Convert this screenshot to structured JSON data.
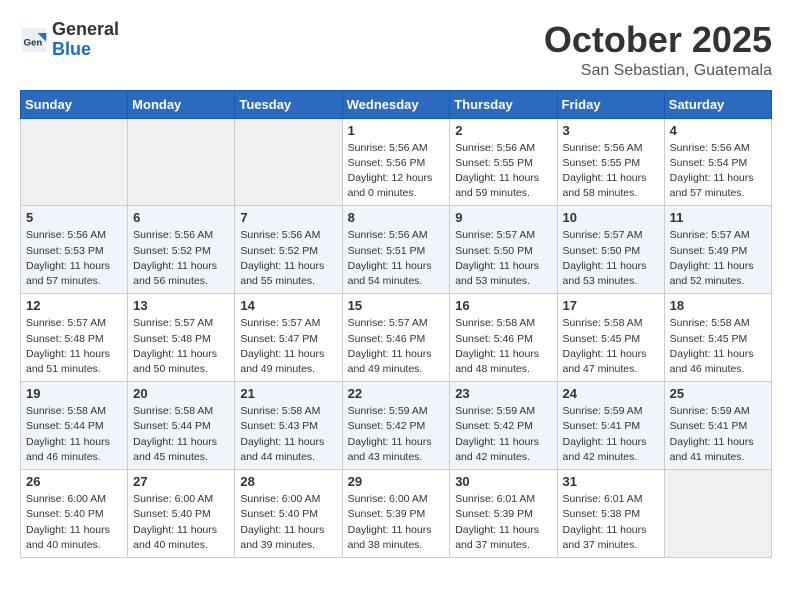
{
  "logo": {
    "general": "General",
    "blue": "Blue"
  },
  "header": {
    "month": "October 2025",
    "location": "San Sebastian, Guatemala"
  },
  "weekdays": [
    "Sunday",
    "Monday",
    "Tuesday",
    "Wednesday",
    "Thursday",
    "Friday",
    "Saturday"
  ],
  "weeks": [
    [
      {
        "day": "",
        "info": ""
      },
      {
        "day": "",
        "info": ""
      },
      {
        "day": "",
        "info": ""
      },
      {
        "day": "1",
        "info": "Sunrise: 5:56 AM\nSunset: 5:56 PM\nDaylight: 12 hours\nand 0 minutes."
      },
      {
        "day": "2",
        "info": "Sunrise: 5:56 AM\nSunset: 5:55 PM\nDaylight: 11 hours\nand 59 minutes."
      },
      {
        "day": "3",
        "info": "Sunrise: 5:56 AM\nSunset: 5:55 PM\nDaylight: 11 hours\nand 58 minutes."
      },
      {
        "day": "4",
        "info": "Sunrise: 5:56 AM\nSunset: 5:54 PM\nDaylight: 11 hours\nand 57 minutes."
      }
    ],
    [
      {
        "day": "5",
        "info": "Sunrise: 5:56 AM\nSunset: 5:53 PM\nDaylight: 11 hours\nand 57 minutes."
      },
      {
        "day": "6",
        "info": "Sunrise: 5:56 AM\nSunset: 5:52 PM\nDaylight: 11 hours\nand 56 minutes."
      },
      {
        "day": "7",
        "info": "Sunrise: 5:56 AM\nSunset: 5:52 PM\nDaylight: 11 hours\nand 55 minutes."
      },
      {
        "day": "8",
        "info": "Sunrise: 5:56 AM\nSunset: 5:51 PM\nDaylight: 11 hours\nand 54 minutes."
      },
      {
        "day": "9",
        "info": "Sunrise: 5:57 AM\nSunset: 5:50 PM\nDaylight: 11 hours\nand 53 minutes."
      },
      {
        "day": "10",
        "info": "Sunrise: 5:57 AM\nSunset: 5:50 PM\nDaylight: 11 hours\nand 53 minutes."
      },
      {
        "day": "11",
        "info": "Sunrise: 5:57 AM\nSunset: 5:49 PM\nDaylight: 11 hours\nand 52 minutes."
      }
    ],
    [
      {
        "day": "12",
        "info": "Sunrise: 5:57 AM\nSunset: 5:48 PM\nDaylight: 11 hours\nand 51 minutes."
      },
      {
        "day": "13",
        "info": "Sunrise: 5:57 AM\nSunset: 5:48 PM\nDaylight: 11 hours\nand 50 minutes."
      },
      {
        "day": "14",
        "info": "Sunrise: 5:57 AM\nSunset: 5:47 PM\nDaylight: 11 hours\nand 49 minutes."
      },
      {
        "day": "15",
        "info": "Sunrise: 5:57 AM\nSunset: 5:46 PM\nDaylight: 11 hours\nand 49 minutes."
      },
      {
        "day": "16",
        "info": "Sunrise: 5:58 AM\nSunset: 5:46 PM\nDaylight: 11 hours\nand 48 minutes."
      },
      {
        "day": "17",
        "info": "Sunrise: 5:58 AM\nSunset: 5:45 PM\nDaylight: 11 hours\nand 47 minutes."
      },
      {
        "day": "18",
        "info": "Sunrise: 5:58 AM\nSunset: 5:45 PM\nDaylight: 11 hours\nand 46 minutes."
      }
    ],
    [
      {
        "day": "19",
        "info": "Sunrise: 5:58 AM\nSunset: 5:44 PM\nDaylight: 11 hours\nand 46 minutes."
      },
      {
        "day": "20",
        "info": "Sunrise: 5:58 AM\nSunset: 5:44 PM\nDaylight: 11 hours\nand 45 minutes."
      },
      {
        "day": "21",
        "info": "Sunrise: 5:58 AM\nSunset: 5:43 PM\nDaylight: 11 hours\nand 44 minutes."
      },
      {
        "day": "22",
        "info": "Sunrise: 5:59 AM\nSunset: 5:42 PM\nDaylight: 11 hours\nand 43 minutes."
      },
      {
        "day": "23",
        "info": "Sunrise: 5:59 AM\nSunset: 5:42 PM\nDaylight: 11 hours\nand 42 minutes."
      },
      {
        "day": "24",
        "info": "Sunrise: 5:59 AM\nSunset: 5:41 PM\nDaylight: 11 hours\nand 42 minutes."
      },
      {
        "day": "25",
        "info": "Sunrise: 5:59 AM\nSunset: 5:41 PM\nDaylight: 11 hours\nand 41 minutes."
      }
    ],
    [
      {
        "day": "26",
        "info": "Sunrise: 6:00 AM\nSunset: 5:40 PM\nDaylight: 11 hours\nand 40 minutes."
      },
      {
        "day": "27",
        "info": "Sunrise: 6:00 AM\nSunset: 5:40 PM\nDaylight: 11 hours\nand 40 minutes."
      },
      {
        "day": "28",
        "info": "Sunrise: 6:00 AM\nSunset: 5:40 PM\nDaylight: 11 hours\nand 39 minutes."
      },
      {
        "day": "29",
        "info": "Sunrise: 6:00 AM\nSunset: 5:39 PM\nDaylight: 11 hours\nand 38 minutes."
      },
      {
        "day": "30",
        "info": "Sunrise: 6:01 AM\nSunset: 5:39 PM\nDaylight: 11 hours\nand 37 minutes."
      },
      {
        "day": "31",
        "info": "Sunrise: 6:01 AM\nSunset: 5:38 PM\nDaylight: 11 hours\nand 37 minutes."
      },
      {
        "day": "",
        "info": ""
      }
    ]
  ]
}
